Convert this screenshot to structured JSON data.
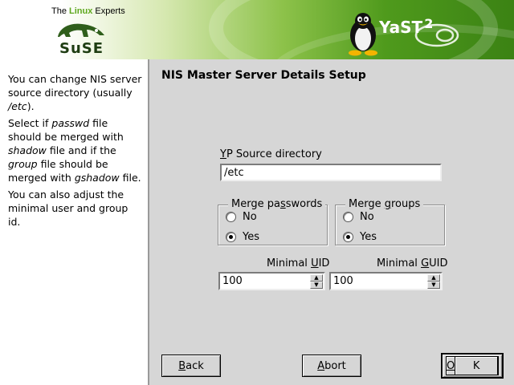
{
  "banner": {
    "tagline_pre": "The ",
    "tagline_hl": "Linux",
    "tagline_post": " Experts",
    "brand": "SuSE",
    "product": "YaST",
    "product_num": "2",
    "accent_color": "#5ea81e",
    "icons": [
      "chameleon-logo",
      "tux-penguin",
      "yast-logo"
    ]
  },
  "help": {
    "p1_a": "You can change NIS server source directory (usually ",
    "p1_em": "/etc",
    "p1_b": ").",
    "p2_a": "Select if ",
    "p2_em1": "passwd",
    "p2_b": " file should be merged with ",
    "p2_em2": "shadow",
    "p2_c": " file and if the ",
    "p2_em3": "group",
    "p2_d": " file should be merged with ",
    "p2_em4": "gshadow",
    "p2_e": " file.",
    "p3": "You can also adjust the minimal user and group id."
  },
  "dialog": {
    "title": "NIS Master Server Details Setup",
    "yp_label_u": "Y",
    "yp_label_rest": "P Source directory",
    "yp_value": "/etc",
    "merge_passwords": {
      "title_a": "Merge pa",
      "title_u": "s",
      "title_b": "swords",
      "no": "No",
      "yes": "Yes",
      "selected": "Yes"
    },
    "merge_groups": {
      "title_a": "Merge ",
      "title_u": "g",
      "title_b": "roups",
      "no": "No",
      "yes": "Yes",
      "selected": "Yes"
    },
    "uid_label_a": "Minimal ",
    "uid_label_u": "U",
    "uid_label_b": "ID",
    "uid_value": "100",
    "gid_label_a": "Minimal ",
    "gid_label_u": "G",
    "gid_label_b": "UID",
    "gid_value": "100"
  },
  "buttons": {
    "back_u": "B",
    "back_rest": "ack",
    "abort_u": "A",
    "abort_rest": "bort",
    "ok_u": "O",
    "ok_rest": "K"
  }
}
